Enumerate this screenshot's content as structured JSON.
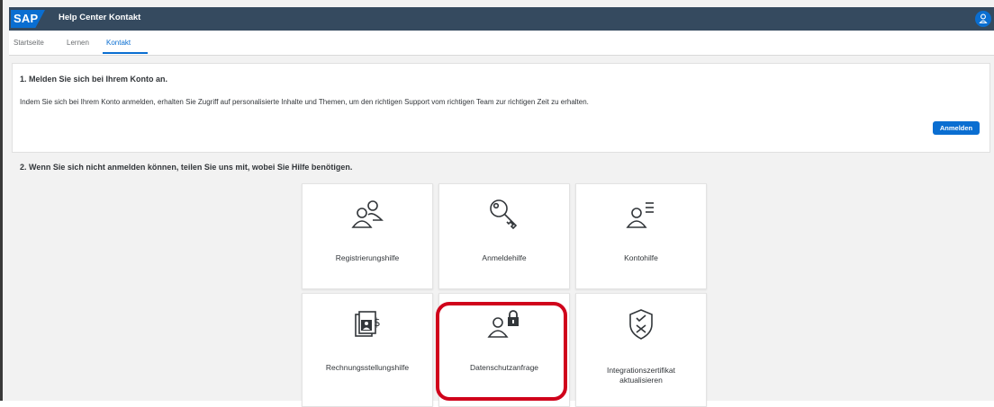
{
  "header": {
    "logo_text": "SAP",
    "app_title": "Help Center Kontakt",
    "avatar_icon": "user-icon"
  },
  "tabs": [
    {
      "label": "Startseite",
      "active": false
    },
    {
      "label": "Lernen",
      "active": false
    },
    {
      "label": "Kontakt",
      "active": true
    }
  ],
  "section1": {
    "heading": "1. Melden Sie sich bei Ihrem Konto an.",
    "text": "Indem Sie sich bei Ihrem Konto anmelden, erhalten Sie Zugriff auf personalisierte Inhalte und Themen, um den richtigen Support vom richtigen Team zur richtigen Zeit zu erhalten.",
    "button_label": "Anmelden"
  },
  "section2": {
    "heading": "2. Wenn Sie sich nicht anmelden können, teilen Sie uns mit, wobei Sie Hilfe benötigen."
  },
  "tiles": [
    {
      "label": "Registrierungshilfe",
      "icon": "users-group-icon"
    },
    {
      "label": "Anmeldehilfe",
      "icon": "key-icon"
    },
    {
      "label": "Kontohilfe",
      "icon": "user-list-icon"
    },
    {
      "label": "Rechnungsstellungshilfe",
      "icon": "billing-document-icon"
    },
    {
      "label": "Datenschutzanfrage",
      "icon": "user-lock-icon"
    },
    {
      "label": "Integrationszertifikat\naktualisieren",
      "icon": "shield-x-icon"
    }
  ],
  "colors": {
    "shell": "#354a5f",
    "accent": "#0a6ed1",
    "highlight": "#d0021b"
  }
}
